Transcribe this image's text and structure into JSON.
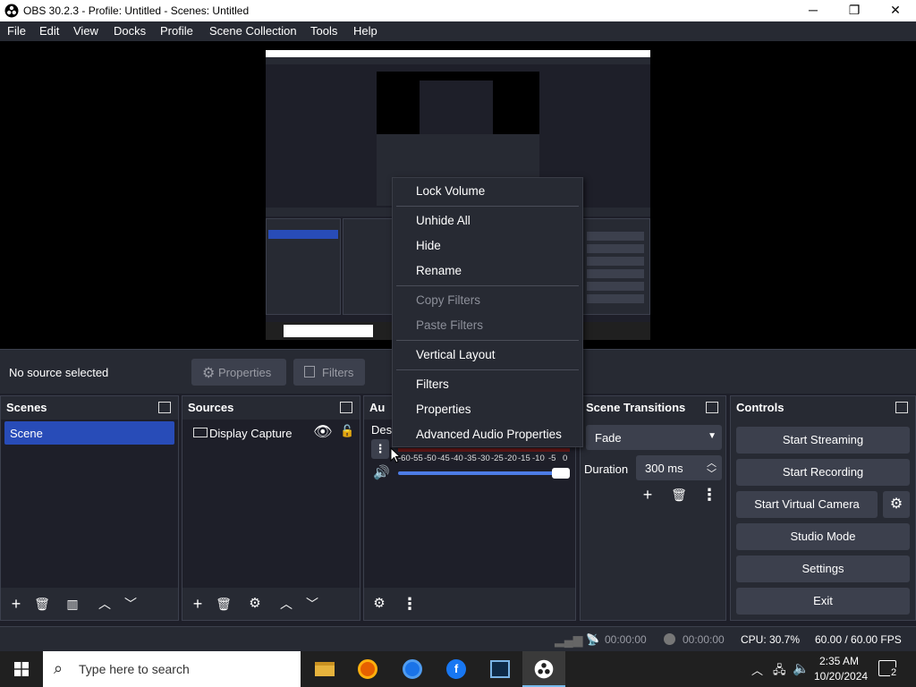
{
  "titlebar": {
    "title": "OBS 30.2.3 - Profile: Untitled - Scenes: Untitled",
    "minimize": "─",
    "maximize": "❐",
    "close": "✕"
  },
  "menu": [
    "File",
    "Edit",
    "View",
    "Docks",
    "Profile",
    "Scene Collection",
    "Tools",
    "Help"
  ],
  "sourcebar": {
    "no_source": "No source selected",
    "properties": "Properties",
    "filters": "Filters"
  },
  "scenes": {
    "title": "Scenes",
    "items": [
      "Scene"
    ]
  },
  "sources": {
    "title": "Sources",
    "items": [
      {
        "name": "Display Capture"
      }
    ]
  },
  "audio": {
    "title": "Au",
    "track": "Des",
    "ticks": [
      "-60",
      "-55",
      "-50",
      "-45",
      "-40",
      "-35",
      "-30",
      "-25",
      "-20",
      "-15",
      "-10",
      "-5",
      "0"
    ]
  },
  "transitions": {
    "title": "Scene Transitions",
    "type": "Fade",
    "duration_label": "Duration",
    "duration_value": "300 ms"
  },
  "controls": {
    "title": "Controls",
    "start_streaming": "Start Streaming",
    "start_recording": "Start Recording",
    "start_virtual_camera": "Start Virtual Camera",
    "studio_mode": "Studio Mode",
    "settings": "Settings",
    "exit": "Exit"
  },
  "context_menu": {
    "lock_volume": "Lock Volume",
    "unhide_all": "Unhide All",
    "hide": "Hide",
    "rename": "Rename",
    "copy_filters": "Copy Filters",
    "paste_filters": "Paste Filters",
    "vertical_layout": "Vertical Layout",
    "filters": "Filters",
    "properties": "Properties",
    "advanced_audio": "Advanced Audio Properties"
  },
  "status": {
    "stream_time": "00:00:00",
    "rec_time": "00:00:00",
    "cpu": "CPU: 30.7%",
    "fps": "60.00 / 60.00 FPS"
  },
  "taskbar": {
    "search_placeholder": "Type here to search",
    "time": "2:35 AM",
    "date": "10/20/2024",
    "notifications": "2"
  },
  "colors": {
    "panel": "#272a33",
    "bg": "#1e1f29",
    "accent": "#284cb8",
    "button": "#3c404d"
  }
}
